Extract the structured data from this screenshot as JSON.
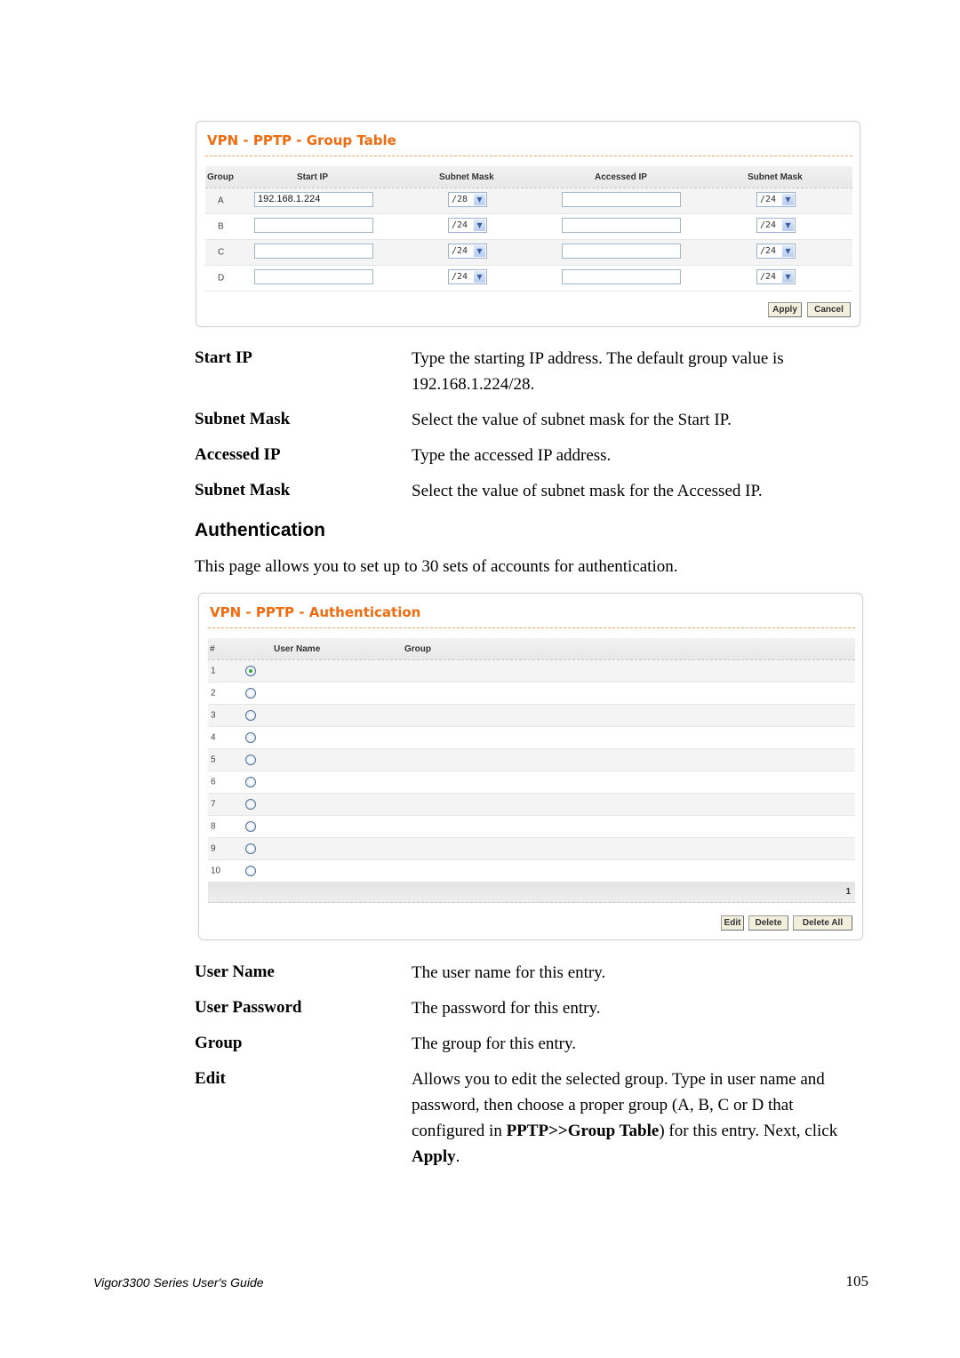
{
  "group_table": {
    "title": "VPN - PPTP - Group Table",
    "columns": [
      "Group",
      "Start IP",
      "Subnet Mask",
      "Accessed IP",
      "Subnet Mask"
    ],
    "rows": [
      {
        "group": "A",
        "start_ip": "192.168.1.224",
        "start_mask": "/28",
        "accessed_ip": "",
        "accessed_mask": "/24"
      },
      {
        "group": "B",
        "start_ip": "",
        "start_mask": "/24",
        "accessed_ip": "",
        "accessed_mask": "/24"
      },
      {
        "group": "C",
        "start_ip": "",
        "start_mask": "/24",
        "accessed_ip": "",
        "accessed_mask": "/24"
      },
      {
        "group": "D",
        "start_ip": "",
        "start_mask": "/24",
        "accessed_ip": "",
        "accessed_mask": "/24"
      }
    ],
    "apply_label": "Apply",
    "cancel_label": "Cancel"
  },
  "group_terms": [
    {
      "term": "Start IP",
      "desc": "Type the starting IP address. The default group value is 192.168.1.224/28."
    },
    {
      "term": "Subnet Mask",
      "desc": "Select the value of subnet mask for the Start IP."
    },
    {
      "term": "Accessed IP",
      "desc": "Type the accessed IP address."
    },
    {
      "term": "Subnet Mask",
      "desc": "Select the value of subnet mask for the Accessed IP."
    }
  ],
  "auth_section": {
    "heading": "Authentication",
    "intro": "This page allows you to set up to 30 sets of accounts for authentication."
  },
  "auth_table": {
    "title": "VPN - PPTP - Authentication",
    "columns": [
      "#",
      "User Name",
      "Group"
    ],
    "rows": [
      {
        "index": "1",
        "selected": true
      },
      {
        "index": "2",
        "selected": false
      },
      {
        "index": "3",
        "selected": false
      },
      {
        "index": "4",
        "selected": false
      },
      {
        "index": "5",
        "selected": false
      },
      {
        "index": "6",
        "selected": false
      },
      {
        "index": "7",
        "selected": false
      },
      {
        "index": "8",
        "selected": false
      },
      {
        "index": "9",
        "selected": false
      },
      {
        "index": "10",
        "selected": false
      }
    ],
    "page": "1",
    "edit_label": "Edit",
    "delete_label": "Delete",
    "delete_all_label": "Delete All"
  },
  "auth_terms": [
    {
      "term": "User Name",
      "desc": "The user name for this entry."
    },
    {
      "term": "User Password",
      "desc": "The password for this entry."
    },
    {
      "term": "Group",
      "desc": "The group for this entry."
    },
    {
      "term": "Edit",
      "desc_parts": [
        "Allows you to edit the selected group. Type in user name and password, then choose a proper group (A, B, C or D that configured in ",
        "PPTP>>Group Table",
        ") for this entry. Next, click ",
        "Apply",
        "."
      ]
    }
  ],
  "footer": {
    "guide_title": "Vigor3300 Series User's Guide",
    "page_number": "105"
  }
}
